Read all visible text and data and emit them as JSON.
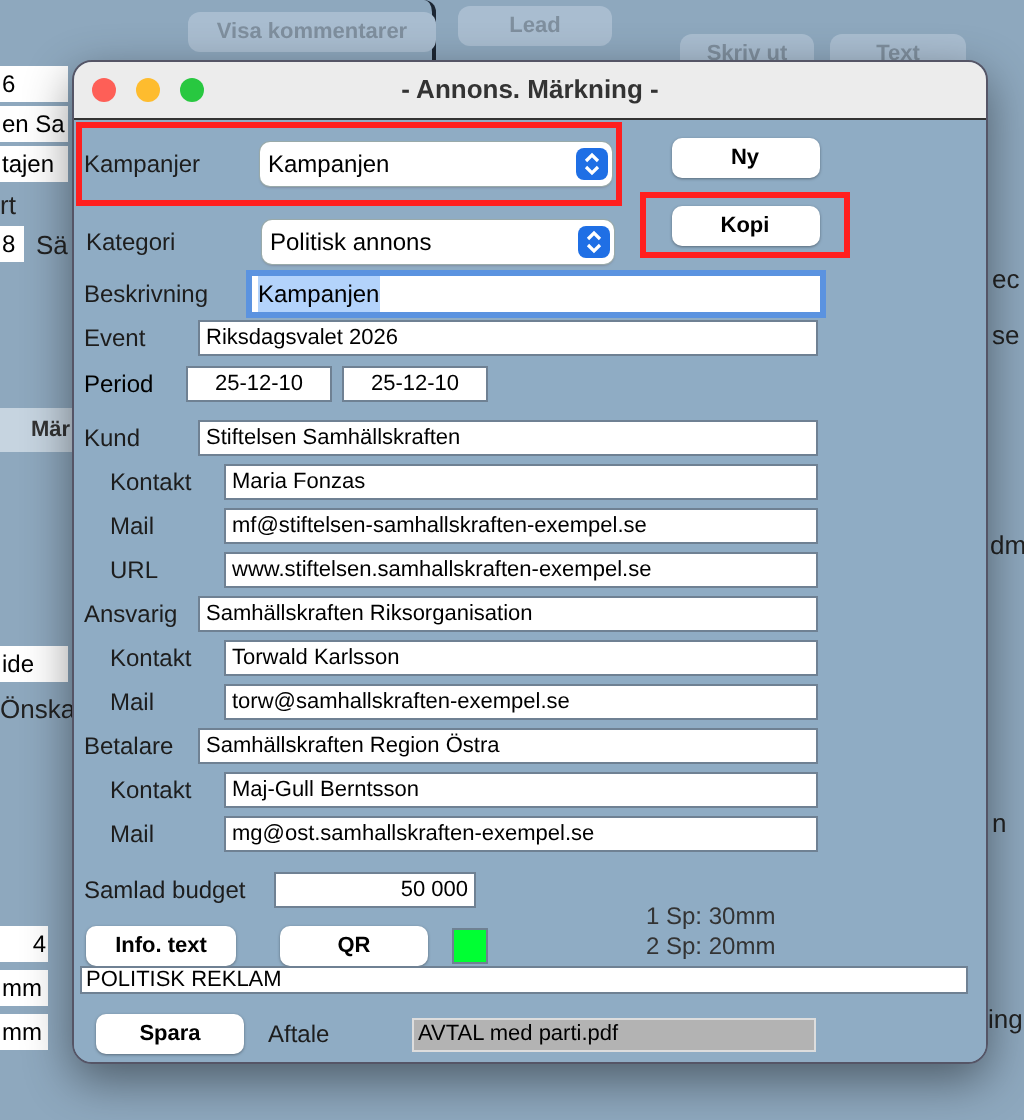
{
  "background": {
    "buttons": [
      "Visa kommentarer",
      "Lead",
      "Skriv ut",
      "Text"
    ],
    "fields": [
      "6",
      "en Sa",
      "tajen",
      "8",
      "ide",
      "4",
      "mm",
      "mm"
    ],
    "labels": [
      "rt",
      "Sä",
      "Önska",
      "ec",
      "se",
      "dm",
      "n",
      "ing"
    ],
    "side_button": "Mär"
  },
  "dialog": {
    "title": "- Annons. Märkning -",
    "campaign": {
      "label": "Kampanjer",
      "value": "Kampanjen",
      "highlighted": true
    },
    "category": {
      "label": "Kategori",
      "value": "Politisk annons"
    },
    "new_button": {
      "label": "Ny",
      "highlighted": false
    },
    "copy_button": {
      "label": "Kopi",
      "highlighted": true
    },
    "description": {
      "label": "Beskrivning",
      "value": "Kampanjen",
      "focused": true
    },
    "event": {
      "label": "Event",
      "value": "Riksdagsvalet 2026"
    },
    "period": {
      "label": "Period",
      "from": "25-12-10",
      "to": "25-12-10"
    },
    "parties": [
      {
        "label": "Kund",
        "value": "Stiftelsen Samhällskraften",
        "children": [
          {
            "label": "Kontakt",
            "value": "Maria Fonzas"
          },
          {
            "label": "Mail",
            "value": "mf@stiftelsen-samhallskraften-exempel.se"
          },
          {
            "label": "URL",
            "value": "www.stiftelsen.samhallskraften-exempel.se"
          }
        ]
      },
      {
        "label": "Ansvarig",
        "value": "Samhällskraften Riksorganisation",
        "children": [
          {
            "label": "Kontakt",
            "value": "Torwald Karlsson"
          },
          {
            "label": "Mail",
            "value": "torw@samhallskraften-exempel.se"
          }
        ]
      },
      {
        "label": "Betalare",
        "value": "Samhällskraften Region Östra",
        "children": [
          {
            "label": "Kontakt",
            "value": "Maj-Gull Berntsson"
          },
          {
            "label": "Mail",
            "value": "mg@ost.samhallskraften-exempel.se"
          }
        ]
      }
    ],
    "budget": {
      "label": "Samlad budget",
      "value": "50 000"
    },
    "info_button": "Info. text",
    "qr_button": "QR",
    "qr_indicator": {
      "on": true
    },
    "sizes": [
      "1 Sp: 30mm",
      "2 Sp: 20mm"
    ],
    "notice": "POLITISK REKLAM",
    "save_button": "Spara",
    "agreement": {
      "label": "Aftale",
      "value": "AVTAL med parti.pdf"
    }
  }
}
